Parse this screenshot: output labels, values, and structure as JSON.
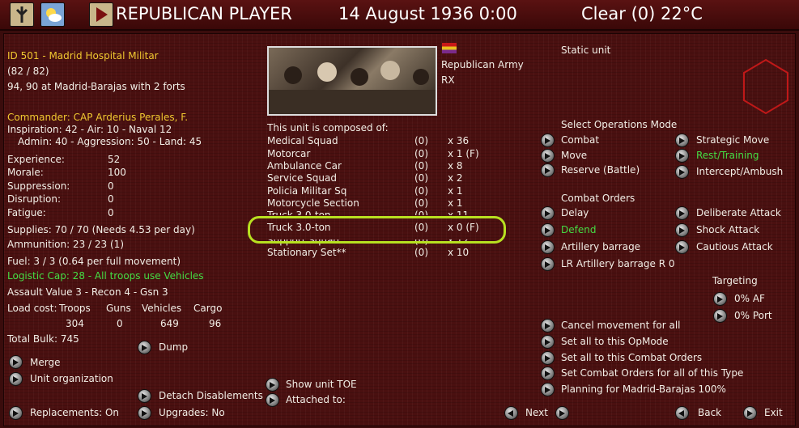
{
  "topbar": {
    "player": "REPUBLICAN PLAYER",
    "date": "14 August 1936 0:00",
    "weather": "Clear (0) 22°C"
  },
  "unit": {
    "id_name": "ID 501 - Madrid Hospital Militar",
    "strength": "(82 / 82)",
    "location": "94, 90 at Madrid-Barajas with 2 forts",
    "commander": "Commander: CAP Arderius Perales, F.",
    "inspiration": "Inspiration: 42 - Air: 10 - Naval 12",
    "admin": "Admin: 40 - Aggression: 50 - Land: 45",
    "stats": [
      {
        "label": "Experience:",
        "value": "52"
      },
      {
        "label": "Morale:",
        "value": "100"
      },
      {
        "label": "Suppression:",
        "value": "0"
      },
      {
        "label": "Disruption:",
        "value": "0"
      },
      {
        "label": "Fatigue:",
        "value": "0"
      }
    ],
    "supplies": "Supplies: 70 / 70 (Needs 4.53 per day)",
    "ammunition": "Ammunition: 23 / 23 (1)",
    "fuel": "Fuel: 3 / 3 (0.64 per full movement)",
    "logistic": "Logistic Cap: 28 - All troops use Vehicles",
    "assault": "Assault Value 3 - Recon 4 - Gsn 3",
    "load_header": {
      "label": "Load cost:",
      "troops": "Troops",
      "guns": "Guns",
      "vehicles": "Vehicles",
      "cargo": "Cargo"
    },
    "load_values": {
      "troops": "304",
      "guns": "0",
      "vehicles": "649",
      "cargo": "96"
    },
    "total_bulk": "Total Bulk: 745",
    "army": "Republican Army",
    "code": "RX",
    "static": "Static unit",
    "composed_label": "This unit is composed of:"
  },
  "composition": [
    {
      "name": "Medical Squad",
      "dmg": "(0)",
      "qty": "x 36"
    },
    {
      "name": "Motorcar",
      "dmg": "(0)",
      "qty": "x 1 (F)"
    },
    {
      "name": "Ambulance Car",
      "dmg": "(0)",
      "qty": "x 8"
    },
    {
      "name": "Service Squad",
      "dmg": "(0)",
      "qty": "x 2"
    },
    {
      "name": "Policia Militar Sq",
      "dmg": "(0)",
      "qty": "x 1"
    },
    {
      "name": "Motorcycle Section",
      "dmg": "(0)",
      "qty": "x 1"
    },
    {
      "name": "Truck 3.0-ton",
      "dmg": "(0)",
      "qty": "x 11"
    },
    {
      "name": "Truck 3.0-ton",
      "dmg": "(0)",
      "qty": "x 0 (F)"
    },
    {
      "name": "Support Squad",
      "dmg": "(0)",
      "qty": "x 12"
    },
    {
      "name": "Stationary Set**",
      "dmg": "(0)",
      "qty": "x 10"
    }
  ],
  "left_buttons": {
    "dump": "Dump",
    "merge": "Merge",
    "unit_org": "Unit organization",
    "detach": "Detach Disablements",
    "replacements": "Replacements: On",
    "upgrades": "Upgrades: No",
    "show_toe": "Show unit TOE",
    "attached": "Attached to:"
  },
  "opmode": {
    "title": "Select Operations Mode",
    "combat": "Combat",
    "move": "Move",
    "reserve": "Reserve (Battle)",
    "strategic": "Strategic Move",
    "rest": "Rest/Training",
    "intercept": "Intercept/Ambush"
  },
  "orders": {
    "title": "Combat Orders",
    "delay": "Delay",
    "defend": "Defend",
    "artillery": "Artillery barrage",
    "lr_artillery": "LR Artillery barrage R 0",
    "deliberate": "Deliberate Attack",
    "shock": "Shock Attack",
    "cautious": "Cautious Attack"
  },
  "targeting": {
    "title": "Targeting",
    "af": "0% AF",
    "port": "0% Port"
  },
  "bulk_actions": {
    "cancel": "Cancel movement for all",
    "set_opmode": "Set all to this OpMode",
    "set_orders": "Set all to this Combat Orders",
    "set_type": "Set Combat Orders for all of this Type",
    "planning": "Planning for Madrid-Barajas 100%"
  },
  "nav": {
    "next": "Next",
    "back": "Back",
    "exit": "Exit"
  },
  "colors": {
    "accent_yellow": "#f0c830",
    "accent_green": "#44dd44",
    "highlight": "#b8e020",
    "panel": "#4a1010"
  }
}
